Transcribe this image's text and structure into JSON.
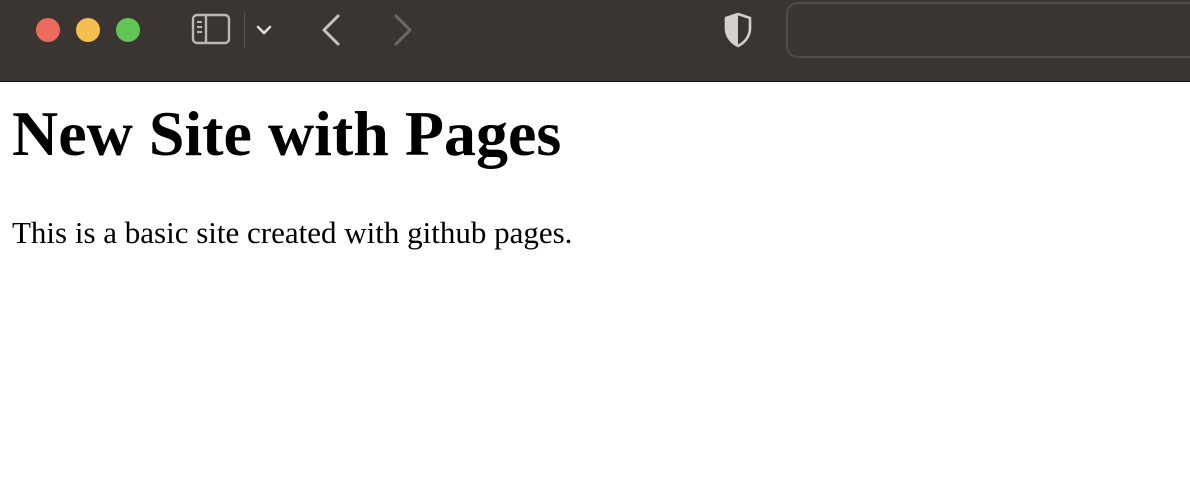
{
  "browser": {
    "address_bar": {
      "value": "",
      "placeholder": ""
    },
    "icons": {
      "sidebar_toggle": "sidebar-icon",
      "sidebar_menu": "chevron-down-icon",
      "back": "chevron-left-icon",
      "forward": "chevron-right-icon",
      "privacy": "shield-icon"
    },
    "colors": {
      "toolbar": "#3b3532",
      "close": "#ed6a5e",
      "minimize": "#f4bf4f",
      "zoom": "#61c554"
    }
  },
  "page": {
    "title": "New Site with Pages",
    "paragraph": "This is a basic site created with github pages."
  }
}
